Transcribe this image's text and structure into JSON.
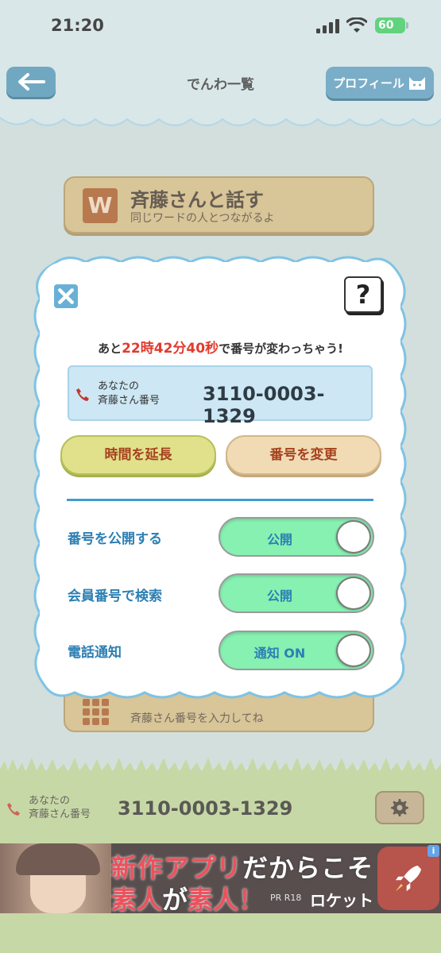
{
  "status_bar": {
    "time": "21:20",
    "battery": "60"
  },
  "header": {
    "title": "でんわ一覧",
    "profile_label": "プロフィール"
  },
  "background": {
    "talk_button": {
      "badge": "W",
      "title": "斉藤さんと話す",
      "subtitle": "同じワードの人とつながるよ"
    },
    "input_button": {
      "subtitle": "斉藤さん番号を入力してね"
    }
  },
  "modal": {
    "countdown": {
      "prefix": "あと",
      "hours": "22",
      "h_unit": "時",
      "minutes": "42",
      "m_unit": "分",
      "seconds": "40",
      "s_unit": "秒",
      "suffix": "で番号が変わっちゃう!"
    },
    "number_label_line1": "あなたの",
    "number_label_line2": "斉藤さん番号",
    "number": "3110-0003-1329",
    "extend_button": "時間を延長",
    "change_button": "番号を変更",
    "settings": [
      {
        "label": "番号を公開する",
        "toggle": "公開",
        "on": true
      },
      {
        "label": "会員番号で検索",
        "toggle": "公開",
        "on": true
      },
      {
        "label": "電話通知",
        "toggle": "通知 ON",
        "on": true
      }
    ],
    "help": "?"
  },
  "bottom_bar": {
    "label_line1": "あなたの",
    "label_line2": "斉藤さん番号",
    "number": "3110-0003-1329"
  },
  "ad": {
    "line1_red": "新作アプリ",
    "line1_white": "だからこそ",
    "line2_red1": "素人",
    "line2_white": "が",
    "line2_red2": "素人！",
    "pr": "PR R18",
    "brand": "ロケット",
    "info": "i"
  },
  "colors": {
    "accent_blue": "#2d7fb3",
    "countdown_red": "#e23b2e",
    "toggle_on": "#86f1b1"
  }
}
